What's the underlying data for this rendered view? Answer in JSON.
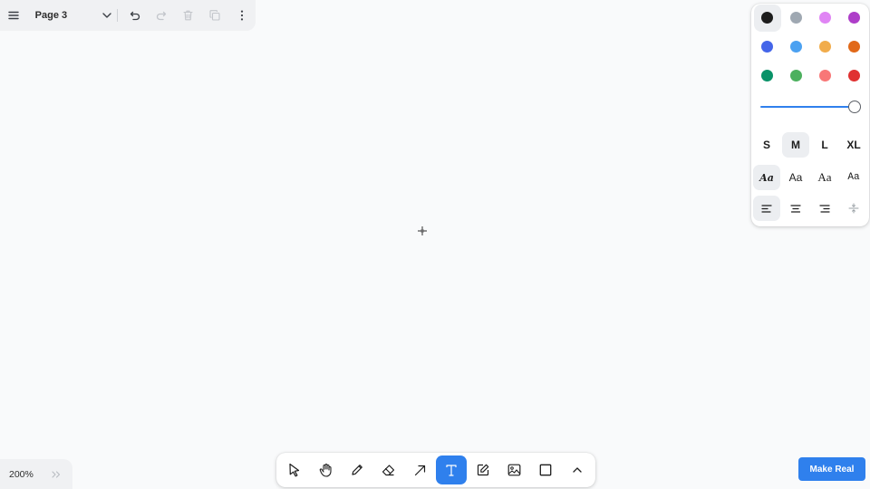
{
  "menu_bar": {
    "page_name": "Page 3",
    "icons": [
      "menu-icon",
      "chevron-down-icon",
      "undo-icon",
      "redo-icon",
      "trash-icon",
      "duplicate-icon",
      "more-icon"
    ]
  },
  "style_panel": {
    "colors": [
      {
        "name": "black",
        "hex": "#1d1d1d",
        "selected": true
      },
      {
        "name": "grey",
        "hex": "#9fa8b2"
      },
      {
        "name": "light-violet",
        "hex": "#e085f4"
      },
      {
        "name": "violet",
        "hex": "#ae3ec9"
      },
      {
        "name": "blue",
        "hex": "#4465e9"
      },
      {
        "name": "light-blue",
        "hex": "#4ba1f1"
      },
      {
        "name": "yellow",
        "hex": "#f1ac4b"
      },
      {
        "name": "orange",
        "hex": "#e16919"
      },
      {
        "name": "green",
        "hex": "#099268"
      },
      {
        "name": "light-green",
        "hex": "#4cb05e"
      },
      {
        "name": "light-red",
        "hex": "#f87777"
      },
      {
        "name": "red",
        "hex": "#e03131"
      }
    ],
    "opacity": 1.0,
    "sizes": [
      "S",
      "M",
      "L",
      "XL"
    ],
    "selected_size": "M",
    "fonts": [
      {
        "label": "Aa",
        "style": "draw"
      },
      {
        "label": "Aa",
        "style": "sans"
      },
      {
        "label": "Aa",
        "style": "serif"
      },
      {
        "label": "Aa",
        "style": "mono"
      }
    ],
    "selected_font": "draw",
    "align": [
      "align-left-icon",
      "align-center-icon",
      "align-right-icon",
      "vertical-align-icon"
    ],
    "selected_align": "align-left-icon"
  },
  "toolbar": {
    "tools": [
      "select-icon",
      "hand-icon",
      "pencil-icon",
      "eraser-icon",
      "arrow-icon",
      "text-icon",
      "note-icon",
      "image-icon",
      "rectangle-icon",
      "chevron-up-icon"
    ],
    "active_tool": "text-icon",
    "accent": "#2f80ed"
  },
  "zoom": {
    "label": "200%"
  },
  "make_real": {
    "label": "Make Real"
  }
}
